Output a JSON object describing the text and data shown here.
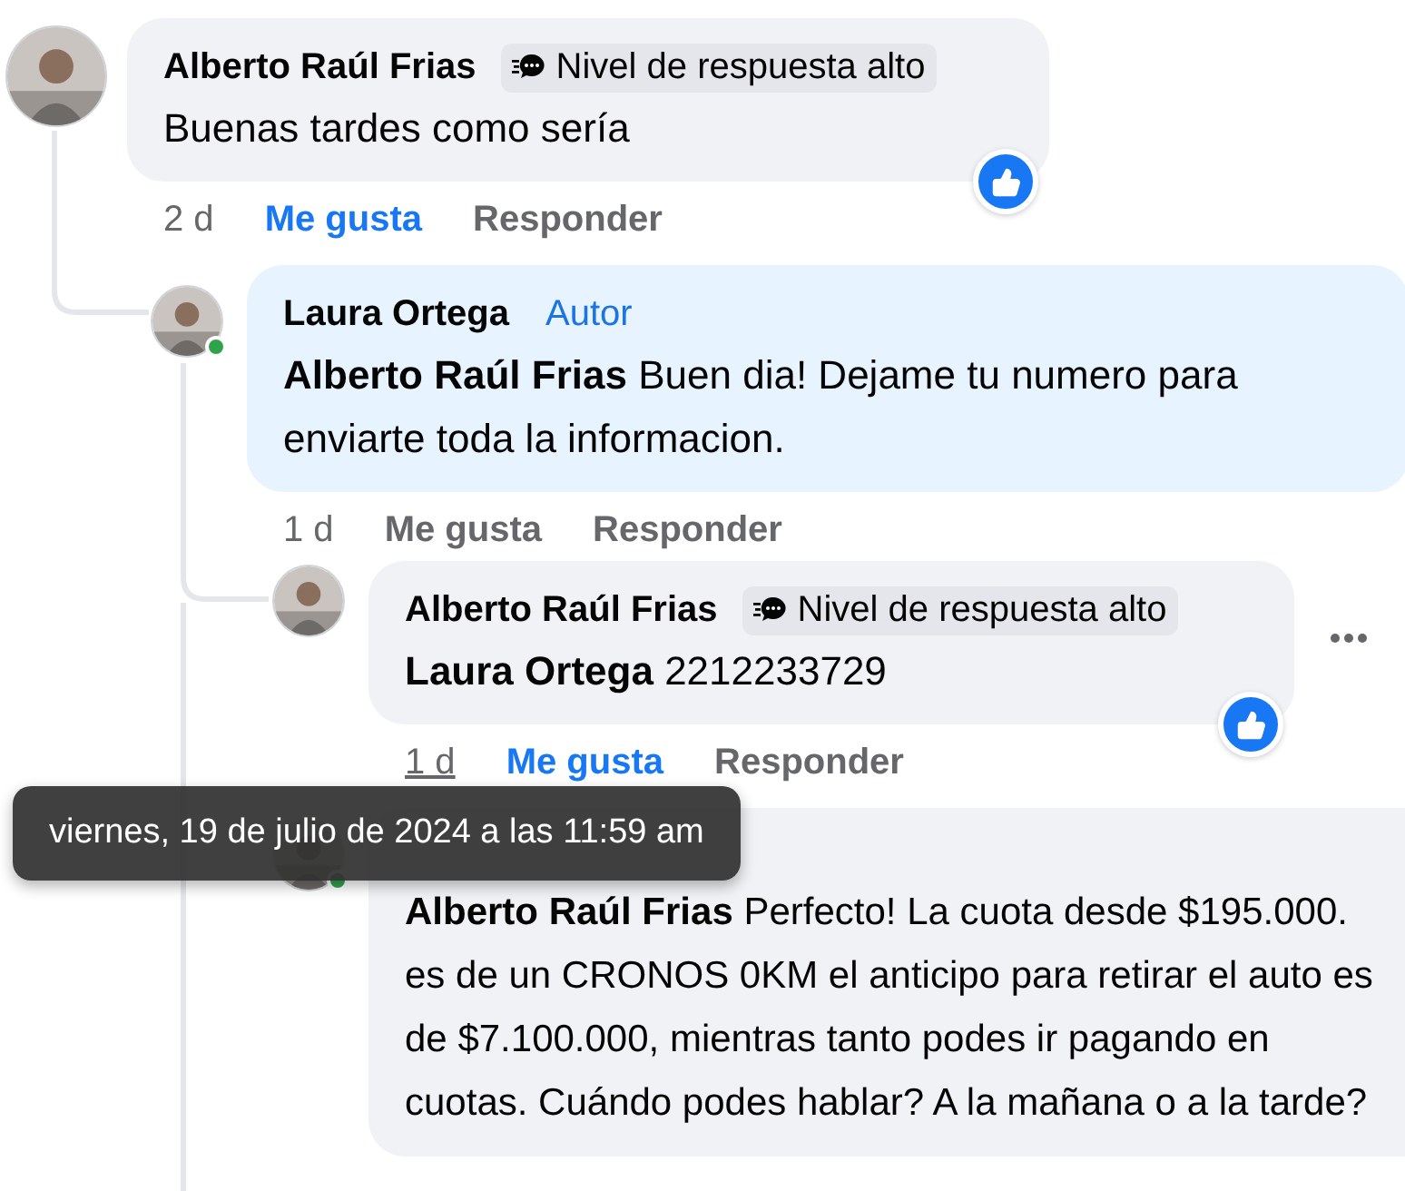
{
  "comments": [
    {
      "author": "Alberto Raúl Frias",
      "badge": {
        "kind": "responsiveness",
        "label": "Nivel de respuesta alto"
      },
      "text": "Buenas tardes como sería",
      "reacted": true,
      "time": "2 d",
      "time_hovered": false,
      "like_label": "Me gusta",
      "liked": true,
      "reply_label": "Responder",
      "children": [
        {
          "author": "Laura Ortega",
          "badge": {
            "kind": "author",
            "label": "Autor"
          },
          "mention": "Alberto Raúl Frias",
          "text": "Buen dia! Dejame tu numero para enviarte toda la informacion.",
          "online": true,
          "time": "1 d",
          "time_hovered": false,
          "like_label": "Me gusta",
          "liked": false,
          "reply_label": "Responder",
          "children": [
            {
              "author": "Alberto Raúl Frias",
              "badge": {
                "kind": "responsiveness",
                "label": "Nivel de respuesta alto"
              },
              "mention": "Laura Ortega",
              "text": "2212233729",
              "reacted": true,
              "menu_visible": true,
              "time": "1 d",
              "time_hovered": true,
              "like_label": "Me gusta",
              "liked": true,
              "reply_label": "Responder"
            },
            {
              "mention": "Alberto Raúl Frias",
              "text": "Perfecto! La cuota desde $195.000. es de un CRONOS 0KM el anticipo para retirar el auto es de $7.100.000, mientras tanto podes ir pagando en cuotas. Cuándo podes hablar? A la mañana o a la tarde?",
              "online": true
            }
          ]
        }
      ]
    }
  ],
  "tooltip": {
    "text": "viernes, 19 de julio de 2024 a las 11:59 am"
  }
}
